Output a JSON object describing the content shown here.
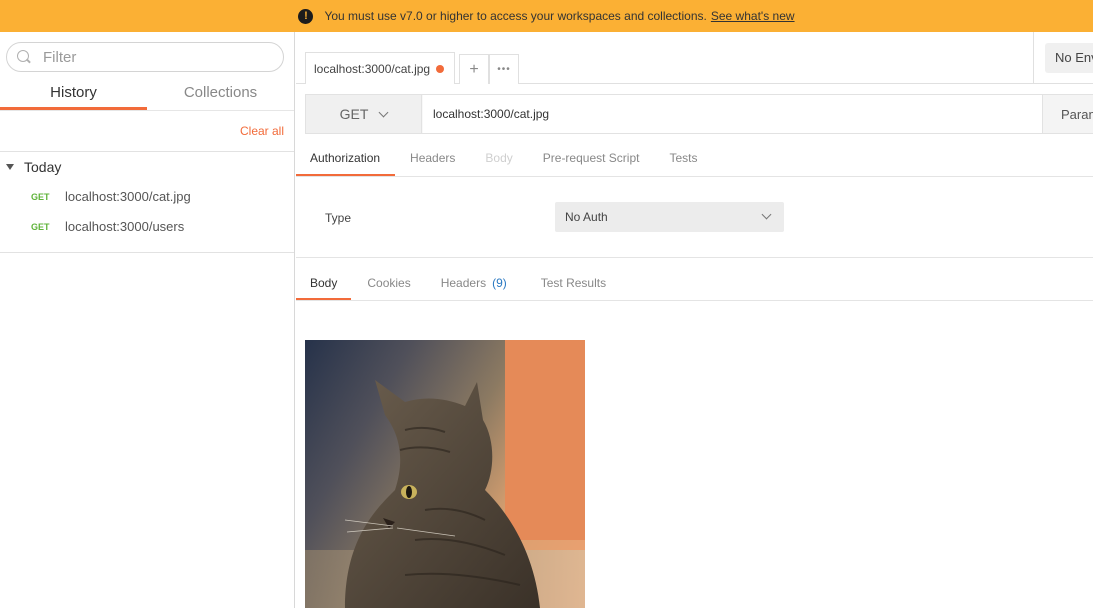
{
  "banner": {
    "message": "You must use v7.0 or higher to access your workspaces and collections.",
    "link": "See what's new"
  },
  "sidebar": {
    "filter_placeholder": "Filter",
    "tabs": [
      {
        "label": "History"
      },
      {
        "label": "Collections"
      }
    ],
    "clear_all": "Clear all",
    "group": "Today",
    "history": [
      {
        "method": "GET",
        "url": "localhost:3000/cat.jpg"
      },
      {
        "method": "GET",
        "url": "localhost:3000/users"
      }
    ]
  },
  "main": {
    "tab": {
      "title": "localhost:3000/cat.jpg"
    },
    "new_tab": "+",
    "more": "•••",
    "environment": "No Environment",
    "request": {
      "method": "GET",
      "url": "localhost:3000/cat.jpg",
      "params": "Params"
    },
    "request_tabs": [
      {
        "label": "Authorization"
      },
      {
        "label": "Headers"
      },
      {
        "label": "Body"
      },
      {
        "label": "Pre-request Script"
      },
      {
        "label": "Tests"
      }
    ],
    "auth": {
      "type_label": "Type",
      "value": "No Auth"
    },
    "response_tabs": [
      {
        "label": "Body"
      },
      {
        "label": "Cookies"
      },
      {
        "label": "Headers",
        "count": "(9)"
      },
      {
        "label": "Test Results"
      }
    ]
  },
  "colors": {
    "banner": "#fbb034",
    "accent": "#f26b3a",
    "get_method": "#5fb33a",
    "count_link": "#2a79c2"
  }
}
